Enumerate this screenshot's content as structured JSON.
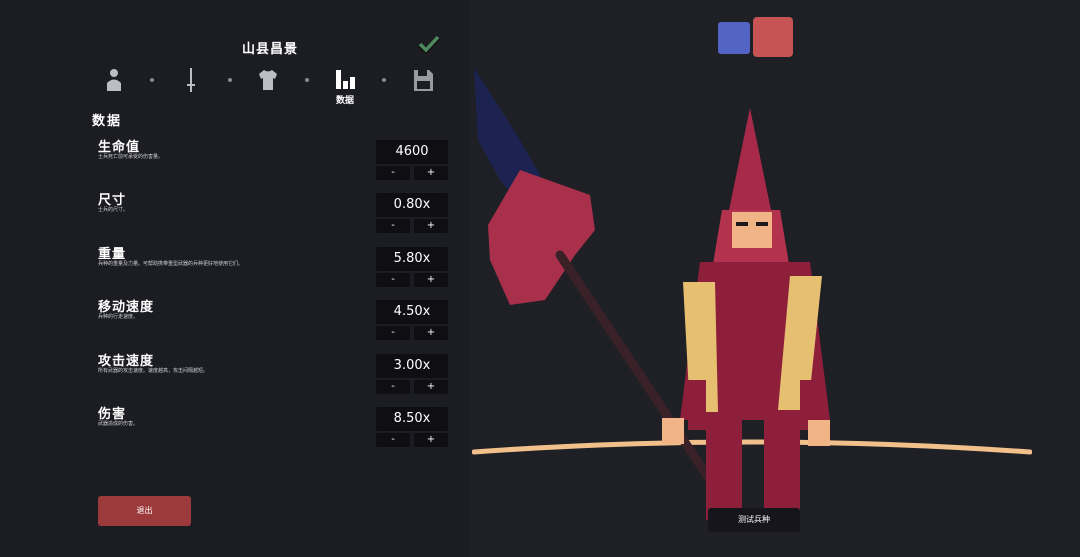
{
  "unit_name": "山县昌景",
  "step_nav": {
    "active_caption": "数据"
  },
  "section_title": "数据",
  "stats": [
    {
      "name": "生命值",
      "desc": "士兵死亡前可承受的伤害量。",
      "value": "4600",
      "minus": "-",
      "plus": "+"
    },
    {
      "name": "尺寸",
      "desc": "士兵的尺寸。",
      "value": "0.80x",
      "minus": "-",
      "plus": "+"
    },
    {
      "name": "重量",
      "desc": "兵种的重量及力量。可帮助携带重型武器的兵种更好地使用它们。",
      "value": "5.80x",
      "minus": "-",
      "plus": "+"
    },
    {
      "name": "移动速度",
      "desc": "兵种的行走速度。",
      "value": "4.50x",
      "minus": "-",
      "plus": "+"
    },
    {
      "name": "攻击速度",
      "desc": "所有武器的攻击速度。速度越高，攻击间隔越短。",
      "value": "3.00x",
      "minus": "-",
      "plus": "+"
    },
    {
      "name": "伤害",
      "desc": "武器造成的伤害。",
      "value": "8.50x",
      "minus": "-",
      "plus": "+"
    }
  ],
  "exit_label": "退出",
  "test_label": "测试兵种",
  "icons": [
    "unit-icon",
    "weapon-icon",
    "clothing-icon",
    "stats-icon",
    "save-icon",
    "checkmark-icon"
  ],
  "colors": {
    "team_blue": "#5464c4",
    "team_red": "#c65454",
    "exit_button": "#9c3a3b",
    "armor": "#8e1f3a",
    "gold": "#e6c070"
  }
}
